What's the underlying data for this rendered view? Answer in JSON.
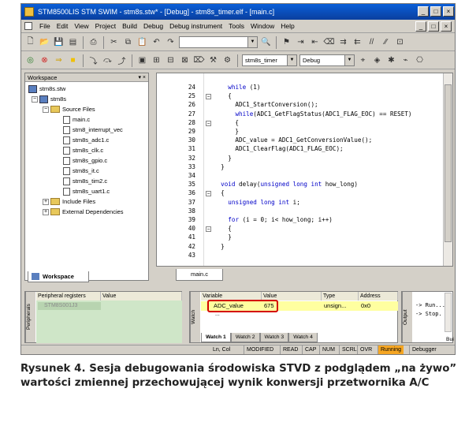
{
  "window": {
    "title": "STM8500LIS STM SWIM - stm8s.stw* - [Debug] - stm8s_timer.elf - [main.c]"
  },
  "menu": [
    "File",
    "Edit",
    "View",
    "Project",
    "Build",
    "Debug",
    "Debug instrument",
    "Tools",
    "Window",
    "Help"
  ],
  "toolbar": {
    "target_combo": "stm8s_timer",
    "config_combo": "Debug"
  },
  "workspace": {
    "title": "Workspace",
    "tab": "Workspace",
    "tree": {
      "root": "stm8s.stw",
      "project": "stm8s",
      "source_folder": "Source Files",
      "files": [
        "main.c",
        "stm8_interrupt_vec",
        "stm8s_adc1.c",
        "stm8s_clk.c",
        "stm8s_gpio.c",
        "stm8s_it.c",
        "stm8s_tim2.c",
        "stm8s_uart1.c"
      ],
      "include_folder": "Include Files",
      "ext_folder": "External Dependencies"
    }
  },
  "editor": {
    "tab": "main.c",
    "lines": [
      {
        "n": "24",
        "t": "    while (1)"
      },
      {
        "n": "25",
        "t": "    {"
      },
      {
        "n": "26",
        "t": "      ADC1_StartConversion();"
      },
      {
        "n": "27",
        "t": "      while(ADC1_GetFlagStatus(ADC1_FLAG_EOC) == RESET)"
      },
      {
        "n": "28",
        "t": "      {"
      },
      {
        "n": "29",
        "t": "      }"
      },
      {
        "n": "30",
        "t": "      ADC_value = ADC1_GetConversionValue();"
      },
      {
        "n": "31",
        "t": "      ADC1_ClearFlag(ADC1_FLAG_EOC);"
      },
      {
        "n": "32",
        "t": "    }"
      },
      {
        "n": "33",
        "t": "  }"
      },
      {
        "n": "34",
        "t": ""
      },
      {
        "n": "35",
        "t": "  void delay(unsigned long int how_long)"
      },
      {
        "n": "36",
        "t": "  {"
      },
      {
        "n": "37",
        "t": "    unsigned long int i;"
      },
      {
        "n": "38",
        "t": ""
      },
      {
        "n": "39",
        "t": "    for (i = 0; i< how_long; i++)"
      },
      {
        "n": "40",
        "t": "    {"
      },
      {
        "n": "41",
        "t": "    }"
      },
      {
        "n": "42",
        "t": "  }"
      },
      {
        "n": "43",
        "t": ""
      }
    ]
  },
  "peripheral": {
    "vtab": "Peripherals",
    "col1": "Peripheral registers",
    "col2": "Value",
    "row": "STM8S001J3"
  },
  "watch": {
    "vtab": "Watch",
    "headers": [
      "Variable",
      "Value",
      "Type",
      "Address"
    ],
    "row": {
      "variable": "ADC_value",
      "value": "675",
      "type": "unsign...",
      "address": "0x0"
    },
    "new_row": "...",
    "tabs": [
      "Watch 1",
      "Watch 2",
      "Watch 3",
      "Watch 4"
    ]
  },
  "output": {
    "vtab": "Output",
    "lines": [
      "-> Run...",
      "-> Stop."
    ],
    "tab": "Bui"
  },
  "status": {
    "pos": "Ln, Col",
    "flags": [
      "MODIFIED",
      "READ",
      "CAP",
      "NUM",
      "SCRL",
      "OVR"
    ],
    "running": "Running",
    "debugger": "Debugger"
  },
  "caption": "Rysunek 4. Sesja debugowania środowiska STVD z podglądem „na żywo” wartości zmiennej przechowującej wynik konwersji przetwornika A/C"
}
